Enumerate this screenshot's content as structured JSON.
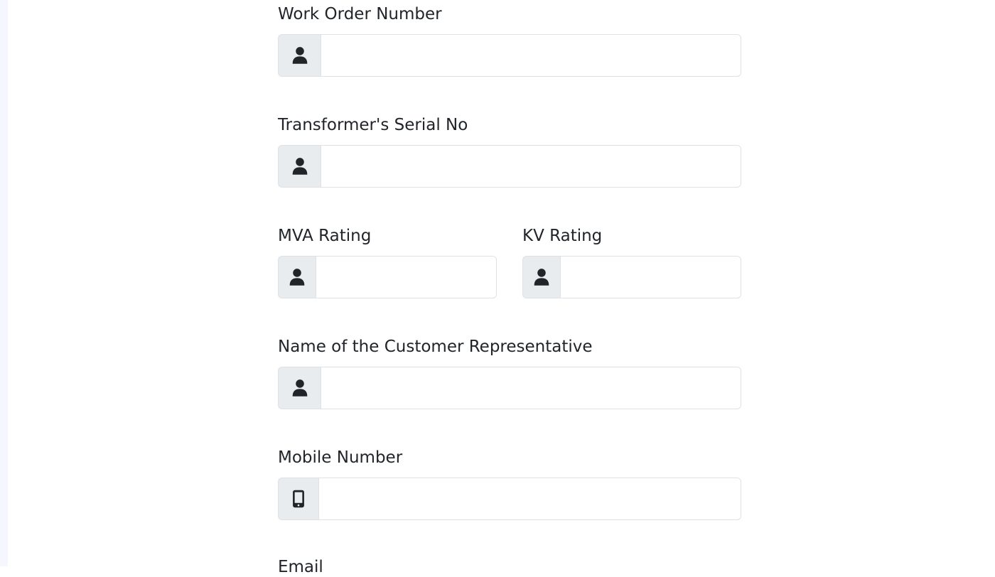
{
  "form": {
    "work_order": {
      "label": "Work Order Number",
      "value": "",
      "icon": "person-icon"
    },
    "serial_no": {
      "label": "Transformer's Serial No",
      "value": "",
      "icon": "person-icon"
    },
    "mva_rating": {
      "label": "MVA Rating",
      "value": "",
      "icon": "person-icon"
    },
    "kv_rating": {
      "label": "KV Rating",
      "value": "",
      "icon": "person-icon"
    },
    "customer_rep": {
      "label": "Name of the Customer Representative",
      "value": "",
      "icon": "person-icon"
    },
    "mobile": {
      "label": "Mobile Number",
      "value": "",
      "icon": "mobile-phone-icon"
    },
    "email": {
      "label": "Email"
    }
  },
  "colors": {
    "addon_bg": "#e9ecef",
    "border": "#dee2e6",
    "text": "#212529",
    "left_strip": "#f5f6fe"
  }
}
